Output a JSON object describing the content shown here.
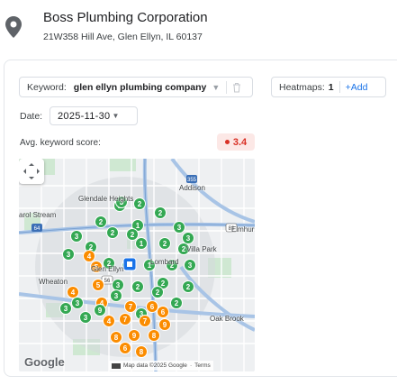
{
  "business": {
    "name": "Boss Plumbing Corporation",
    "address": "21W358 Hill Ave, Glen Ellyn, IL 60137"
  },
  "keyword": {
    "label": "Keyword:",
    "value": "glen ellyn plumbing company"
  },
  "heatmaps": {
    "label": "Heatmaps:",
    "count": "1",
    "add_label": "+Add"
  },
  "date": {
    "label": "Date:",
    "value": "2025-11-30"
  },
  "score": {
    "label": "Avg. keyword score:",
    "value": "3.4",
    "color": "#d93025"
  },
  "map": {
    "place_labels": {
      "glendale_heights": "Glendale Heights",
      "carol_stream": "arol Stream",
      "addison": "Addison",
      "elmhurst": "Elmhurst",
      "villa_park": "Villa Park",
      "lombard": "Lombard",
      "glen_ellyn": "Glen Ellyn",
      "wheaton": "Wheaton",
      "oak_brook": "Oak Brook"
    },
    "road_shields": {
      "r64": "64",
      "r355": "355",
      "r83": "83",
      "r56": "56"
    },
    "google_label": "Google",
    "attribution": {
      "map_data": "Map data ©2025 Google",
      "terms": "Terms"
    },
    "colors": {
      "good": "#34a853",
      "medium": "#fb8c00",
      "poor": "#e53935",
      "center": "#1a73e8"
    },
    "pins": [
      {
        "rank": "1",
        "level": "good"
      },
      {
        "rank": "2",
        "level": "good"
      },
      {
        "rank": "2",
        "level": "good"
      },
      {
        "rank": "1",
        "level": "good"
      },
      {
        "rank": "2",
        "level": "good"
      },
      {
        "rank": "3",
        "level": "good"
      },
      {
        "rank": "2",
        "level": "good"
      },
      {
        "rank": "2",
        "level": "good"
      },
      {
        "rank": "2",
        "level": "good"
      },
      {
        "rank": "1",
        "level": "good"
      },
      {
        "rank": "2",
        "level": "good"
      },
      {
        "rank": "2",
        "level": "good"
      },
      {
        "rank": "3",
        "level": "good"
      },
      {
        "rank": "3",
        "level": "good"
      },
      {
        "rank": "4",
        "level": "medium"
      },
      {
        "rank": "2",
        "level": "good"
      },
      {
        "rank": "2",
        "level": "good"
      },
      {
        "rank": "1",
        "level": "good"
      },
      {
        "rank": "2",
        "level": "good"
      },
      {
        "rank": "3",
        "level": "good"
      },
      {
        "rank": "3",
        "level": "good"
      },
      {
        "rank": "2",
        "level": "good"
      },
      {
        "rank": "2",
        "level": "good"
      },
      {
        "rank": "4",
        "level": "medium"
      },
      {
        "rank": "5",
        "level": "medium"
      },
      {
        "rank": "2",
        "level": "good"
      },
      {
        "rank": "2",
        "level": "good"
      },
      {
        "rank": "3",
        "level": "good"
      },
      {
        "rank": "4",
        "level": "medium"
      },
      {
        "rank": "3",
        "level": "good"
      },
      {
        "rank": "2",
        "level": "good"
      },
      {
        "rank": "3",
        "level": "good"
      },
      {
        "rank": "3",
        "level": "good"
      },
      {
        "rank": "4",
        "level": "medium"
      },
      {
        "rank": "7",
        "level": "medium"
      },
      {
        "rank": "7",
        "level": "medium"
      },
      {
        "rank": "9",
        "level": "medium"
      },
      {
        "rank": "7",
        "level": "medium"
      },
      {
        "rank": "8",
        "level": "medium"
      },
      {
        "rank": "9",
        "level": "medium"
      },
      {
        "rank": "8",
        "level": "medium"
      },
      {
        "rank": "9",
        "level": "good"
      },
      {
        "rank": "3",
        "level": "good"
      },
      {
        "rank": "3",
        "level": "good"
      },
      {
        "rank": "3",
        "level": "good"
      },
      {
        "rank": "5",
        "level": "medium"
      },
      {
        "rank": "6",
        "level": "medium"
      },
      {
        "rank": "6",
        "level": "medium"
      },
      {
        "rank": "6",
        "level": "medium"
      },
      {
        "rank": "8",
        "level": "medium"
      }
    ]
  }
}
